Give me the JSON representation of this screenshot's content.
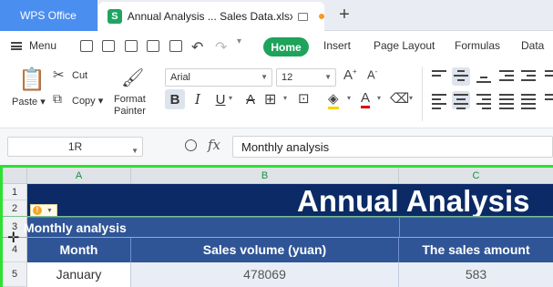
{
  "tabs": {
    "app_tab": "WPS Office",
    "doc_logo": "S",
    "doc_title": "Annual Analysis ... Sales Data.xlsx",
    "new_tab": "+"
  },
  "menu": {
    "menu_label": "Menu",
    "tabs": [
      "Home",
      "Insert",
      "Page Layout",
      "Formulas",
      "Data"
    ]
  },
  "ribbon": {
    "paste": "Paste",
    "cut": "Cut",
    "copy": "Copy",
    "format_painter_line1": "Format",
    "format_painter_line2": "Painter",
    "font": "Arial",
    "font_size": "12",
    "bold": "B",
    "italic": "I",
    "underline": "U",
    "strike": "A"
  },
  "formula_bar": {
    "name_box": "1R",
    "fx": "fx",
    "value": "Monthly analysis"
  },
  "sheet": {
    "columns": [
      "A",
      "B",
      "C"
    ],
    "rows": [
      "1",
      "2",
      "3",
      "4",
      "5"
    ],
    "title": "Annual Analysis",
    "subtitle": "Monthly analysis",
    "warning_glyph": "!",
    "headers": [
      "Month",
      "Sales volume (yuan)",
      "The sales amount"
    ],
    "row5": [
      "January",
      "478069",
      "583"
    ]
  },
  "colors": {
    "app_tab": "#4a8ef0",
    "home_pill": "#1ea35b",
    "title_band": "#0b2a66",
    "header_band": "#2f5597",
    "selection_frame": "#2ee030"
  }
}
